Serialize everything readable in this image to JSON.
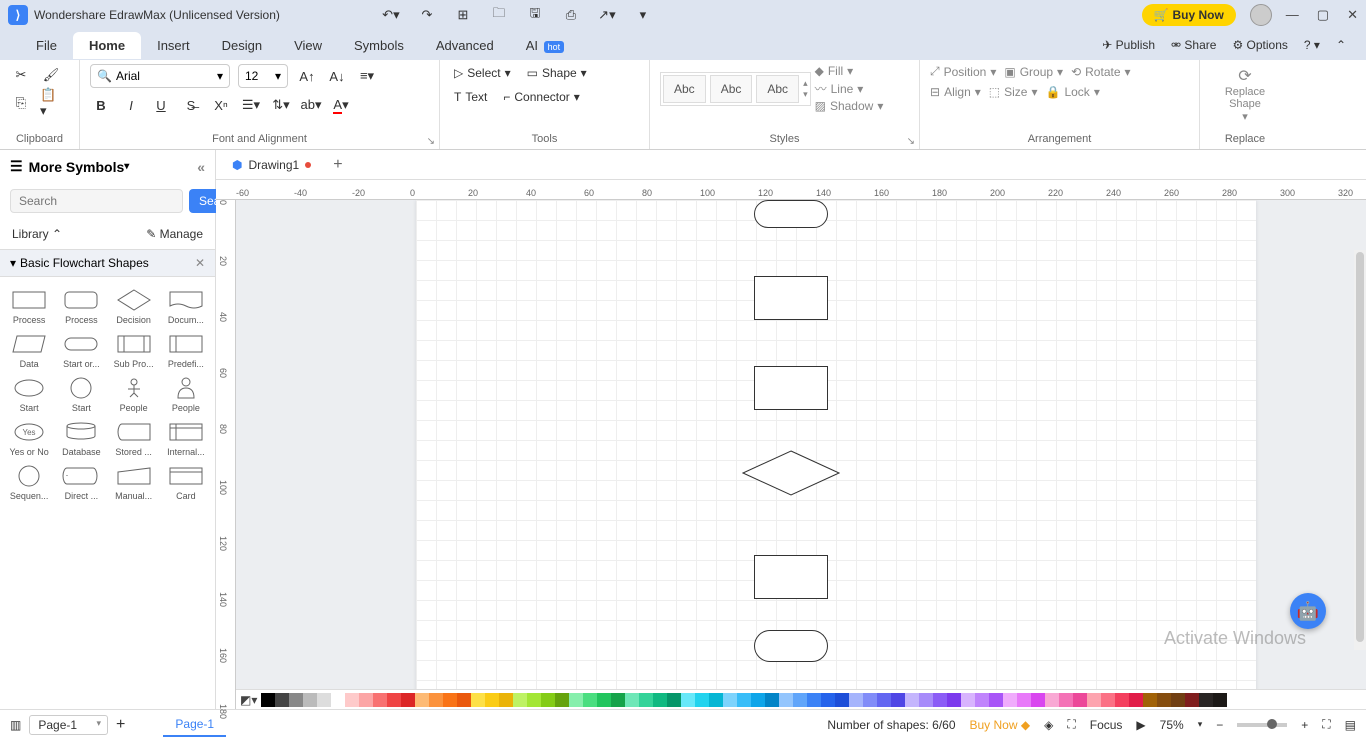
{
  "title": "Wondershare EdrawMax (Unlicensed Version)",
  "buynow": "Buy Now",
  "menu": {
    "file": "File",
    "home": "Home",
    "insert": "Insert",
    "design": "Design",
    "view": "View",
    "symbols": "Symbols",
    "advanced": "Advanced",
    "ai": "AI",
    "hot": "hot",
    "publish": "Publish",
    "share": "Share",
    "options": "Options"
  },
  "ribbon": {
    "clipboard": "Clipboard",
    "fontalign": "Font and Alignment",
    "tools": "Tools",
    "styles": "Styles",
    "arrangement": "Arrangement",
    "replace": "Replace",
    "fontname": "Arial",
    "fontsize": "12",
    "select": "Select",
    "shape": "Shape",
    "text": "Text",
    "connector": "Connector",
    "abc": "Abc",
    "fill": "Fill",
    "line": "Line",
    "shadow": "Shadow",
    "position": "Position",
    "group": "Group",
    "rotate": "Rotate",
    "align": "Align",
    "size": "Size",
    "lock": "Lock",
    "replaceShape": "Replace\nShape"
  },
  "sidebar": {
    "more": "More Symbols",
    "search_ph": "Search",
    "search_btn": "Search",
    "library": "Library",
    "manage": "Manage",
    "section": "Basic Flowchart Shapes",
    "shapes": [
      "Process",
      "Process",
      "Decision",
      "Docum...",
      "Data",
      "Start or...",
      "Sub Pro...",
      "Predefi...",
      "Start",
      "Start",
      "People",
      "People",
      "Yes or No",
      "Database",
      "Stored ...",
      "Internal...",
      "Sequen...",
      "Direct ...",
      "Manual...",
      "Card"
    ]
  },
  "doc": {
    "name": "Drawing1"
  },
  "ruler_h": [
    "-60",
    "-40",
    "-20",
    "0",
    "20",
    "40",
    "60",
    "80",
    "100",
    "120",
    "140",
    "160",
    "180",
    "200",
    "220",
    "240",
    "260",
    "280",
    "300",
    "320"
  ],
  "ruler_v": [
    "0",
    "20",
    "40",
    "60",
    "80",
    "100",
    "120",
    "140",
    "160",
    "180"
  ],
  "colors": [
    "#000",
    "#444",
    "#888",
    "#bbb",
    "#ddd",
    "#fff",
    "#fecaca",
    "#fca5a5",
    "#f87171",
    "#ef4444",
    "#dc2626",
    "#fdba74",
    "#fb923c",
    "#f97316",
    "#ea580c",
    "#fde047",
    "#facc15",
    "#eab308",
    "#bef264",
    "#a3e635",
    "#84cc16",
    "#65a30d",
    "#86efac",
    "#4ade80",
    "#22c55e",
    "#16a34a",
    "#6ee7b7",
    "#34d399",
    "#10b981",
    "#059669",
    "#67e8f9",
    "#22d3ee",
    "#06b6d4",
    "#7dd3fc",
    "#38bdf8",
    "#0ea5e9",
    "#0284c7",
    "#93c5fd",
    "#60a5fa",
    "#3b82f6",
    "#2563eb",
    "#1d4ed8",
    "#a5b4fc",
    "#818cf8",
    "#6366f1",
    "#4f46e5",
    "#c4b5fd",
    "#a78bfa",
    "#8b5cf6",
    "#7c3aed",
    "#d8b4fe",
    "#c084fc",
    "#a855f7",
    "#f0abfc",
    "#e879f9",
    "#d946ef",
    "#f9a8d4",
    "#f472b6",
    "#ec4899",
    "#fda4af",
    "#fb7185",
    "#f43f5e",
    "#e11d48",
    "#a16207",
    "#854d0e",
    "#713f12",
    "#7f1d1d",
    "#292524",
    "#1c1917"
  ],
  "status": {
    "page": "Page-1",
    "pagetab": "Page-1",
    "shapes": "Number of shapes: 6/60",
    "buynow": "Buy Now",
    "focus": "Focus",
    "zoom": "75%"
  },
  "watermark": "Activate Windows"
}
